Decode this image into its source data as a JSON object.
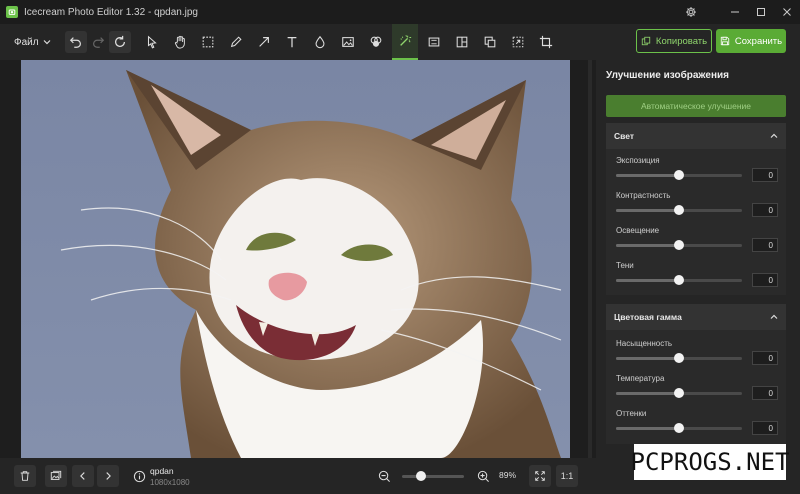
{
  "app": {
    "title": "Icecream Photo Editor 1.32 - qpdan.jpg"
  },
  "menu": {
    "file_label": "Файл"
  },
  "actions": {
    "copy_label": "Копировать",
    "save_label": "Сохранить"
  },
  "panel": {
    "title": "Улучшение изображения",
    "auto_label": "Автоматическое улучшение",
    "sections": [
      {
        "title": "Свет",
        "sliders": [
          {
            "label": "Экспозиция",
            "value": "0",
            "level": 0.5
          },
          {
            "label": "Контрастность",
            "value": "0",
            "level": 0.5
          },
          {
            "label": "Освещение",
            "value": "0",
            "level": 0.5
          },
          {
            "label": "Тени",
            "value": "0",
            "level": 0.5
          }
        ]
      },
      {
        "title": "Цветовая гамма",
        "sliders": [
          {
            "label": "Насыщенность",
            "value": "0",
            "level": 0.5
          },
          {
            "label": "Температура",
            "value": "0",
            "level": 0.5
          },
          {
            "label": "Оттенки",
            "value": "0",
            "level": 0.5
          }
        ]
      }
    ]
  },
  "file": {
    "name": "qpdan",
    "size": "1080x1080"
  },
  "zoom": {
    "value": "89%",
    "level": 0.3,
    "fit_label": "1:1"
  },
  "watermark": "PCPROGS.NET",
  "colors": {
    "accent": "#6cc24a",
    "save": "#5aab35",
    "background": "#1e1e1e",
    "panel": "#252525"
  },
  "icons": [
    "app-logo-icon",
    "settings-gear-icon",
    "minimize-icon",
    "maximize-icon",
    "close-icon",
    "undo-icon",
    "redo-icon",
    "reset-icon",
    "select-arrow-icon",
    "hand-icon",
    "crop-select-icon",
    "pencil-icon",
    "arrow-icon",
    "text-icon",
    "blur-drop-icon",
    "image-icon",
    "color-fill-icon",
    "enhance-wand-icon",
    "resize-icon",
    "layout-icon",
    "frames-icon",
    "crop-area-icon",
    "crop-icon",
    "copy-icon",
    "save-icon",
    "delete-icon",
    "gallery-icon",
    "previous-icon",
    "next-icon",
    "info-icon",
    "zoom-out-icon",
    "zoom-in-icon",
    "fullscreen-icon"
  ]
}
